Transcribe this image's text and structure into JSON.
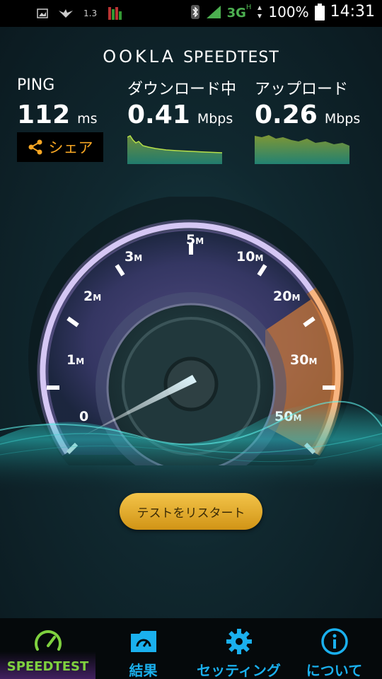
{
  "status_bar": {
    "left_icons": [
      "image-icon",
      "bird-icon",
      "app-icon",
      "level-icon"
    ],
    "left_text": "1.3",
    "network": "3G",
    "network_sup": "H",
    "battery": "100%",
    "time": "14:31"
  },
  "app": {
    "logo_brand": "OOKLA",
    "logo_product": "SPEEDTEST"
  },
  "stats": {
    "ping": {
      "label": "PING",
      "value": "112",
      "unit": "ms"
    },
    "download": {
      "label": "ダウンロード中",
      "value": "0.41",
      "unit": "Mbps"
    },
    "upload": {
      "label": "アップロード",
      "value": "0.26",
      "unit": "Mbps"
    },
    "share_label": "シェア"
  },
  "gauge": {
    "ticks": [
      {
        "num": "0",
        "unit": ""
      },
      {
        "num": "1",
        "unit": "M"
      },
      {
        "num": "2",
        "unit": "M"
      },
      {
        "num": "3",
        "unit": "M"
      },
      {
        "num": "5",
        "unit": "M"
      },
      {
        "num": "10",
        "unit": "M"
      },
      {
        "num": "20",
        "unit": "M"
      },
      {
        "num": "30",
        "unit": "M"
      },
      {
        "num": "50",
        "unit": "M"
      }
    ],
    "needle_value_mbps": 0.41
  },
  "restart_label": "テストをリスタート",
  "nav": [
    {
      "label": "SPEEDTEST",
      "icon": "speedometer-icon",
      "active": true
    },
    {
      "label": "結果",
      "icon": "results-folder-icon",
      "active": false
    },
    {
      "label": "セッティング",
      "icon": "gear-icon",
      "active": false
    },
    {
      "label": "について",
      "icon": "info-icon",
      "active": false
    }
  ],
  "colors": {
    "accent_orange": "#f6a623",
    "nav_active": "#7fd13f",
    "nav_blue": "#1ab0ee",
    "gauge_purple": "#a98ce0",
    "gauge_orange": "#f08a3c"
  }
}
